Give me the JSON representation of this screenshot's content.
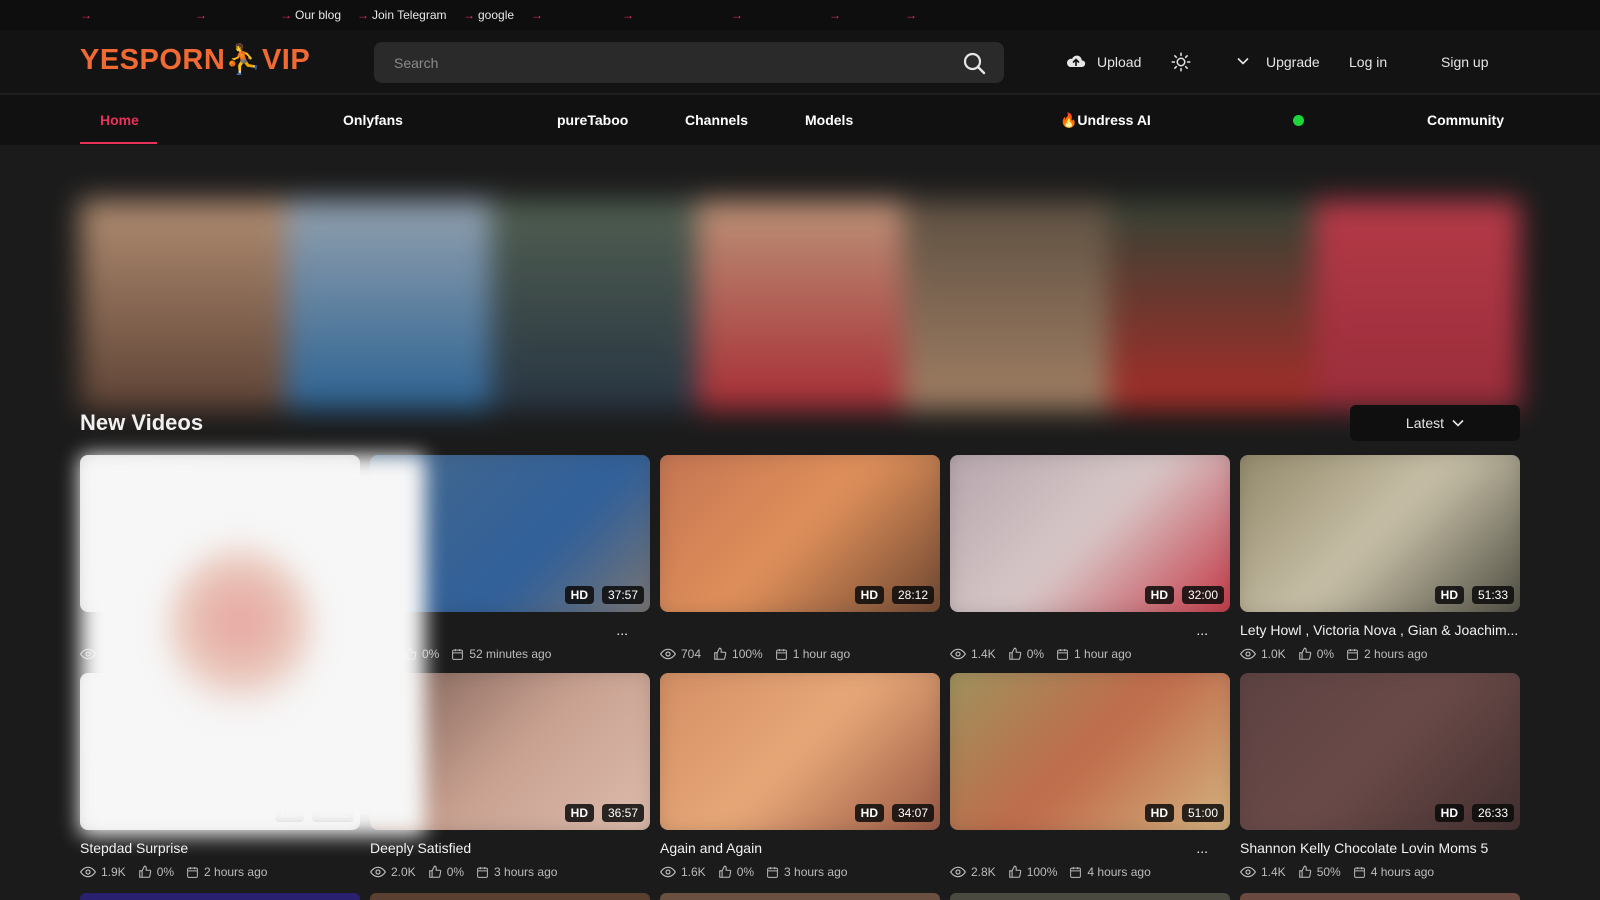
{
  "topbar": {
    "links": [
      {
        "label": ""
      },
      {
        "label": ""
      },
      {
        "label": "Our blog"
      },
      {
        "label": "Join Telegram"
      },
      {
        "label": "google"
      },
      {
        "label": ""
      },
      {
        "label": ""
      },
      {
        "label": ""
      },
      {
        "label": ""
      },
      {
        "label": ""
      }
    ]
  },
  "header": {
    "logo_part1": "YESPORN",
    "logo_part2": "VIP",
    "search_placeholder": "Search",
    "upload_label": "Upload",
    "upgrade_label": "Upgrade",
    "login_label": "Log in",
    "signup_label": "Sign up",
    "icons": [
      "cloud-upload-icon",
      "sun-icon",
      "chevron-down-icon",
      "search-icon"
    ]
  },
  "nav": {
    "items": [
      {
        "label": "Home",
        "active": true
      },
      {
        "label": "Onlyfans"
      },
      {
        "label": "pureTaboo"
      },
      {
        "label": "Channels"
      },
      {
        "label": "Models"
      },
      {
        "label": "🔥Undress AI"
      },
      {
        "label": "Community"
      }
    ],
    "accent_color": "#e8325a",
    "live_color": "#1ed63a"
  },
  "section": {
    "title": "New Videos",
    "sort_label": "Latest"
  },
  "videos": [
    {
      "title": "",
      "views": "",
      "likes": "",
      "age": "",
      "hd": "",
      "duration": ""
    },
    {
      "title": "...",
      "views": "",
      "likes": "0%",
      "age": "52 minutes ago",
      "hd": "HD",
      "duration": "37:57"
    },
    {
      "title": "",
      "views": "704",
      "likes": "100%",
      "age": "1 hour ago",
      "hd": "HD",
      "duration": "28:12"
    },
    {
      "title": "...",
      "views": "1.4K",
      "likes": "0%",
      "age": "1 hour ago",
      "hd": "HD",
      "duration": "32:00"
    },
    {
      "title": "Lety Howl , Victoria Nova , Gian & Joachim...",
      "views": "1.0K",
      "likes": "0%",
      "age": "2 hours ago",
      "hd": "HD",
      "duration": "51:33"
    },
    {
      "title": "Stepdad Surprise",
      "views": "1.9K",
      "likes": "0%",
      "age": "2 hours ago",
      "hd": "HD",
      "duration": "39:52"
    },
    {
      "title": "Deeply Satisfied",
      "views": "2.0K",
      "likes": "0%",
      "age": "3 hours ago",
      "hd": "HD",
      "duration": "36:57"
    },
    {
      "title": "Again and Again",
      "views": "1.6K",
      "likes": "0%",
      "age": "3 hours ago",
      "hd": "HD",
      "duration": "34:07"
    },
    {
      "title": "...",
      "views": "2.8K",
      "likes": "100%",
      "age": "4 hours ago",
      "hd": "HD",
      "duration": "51:00"
    },
    {
      "title": "Shannon Kelly Chocolate Lovin Moms 5",
      "views": "1.4K",
      "likes": "50%",
      "age": "4 hours ago",
      "hd": "HD",
      "duration": "26:33"
    }
  ]
}
